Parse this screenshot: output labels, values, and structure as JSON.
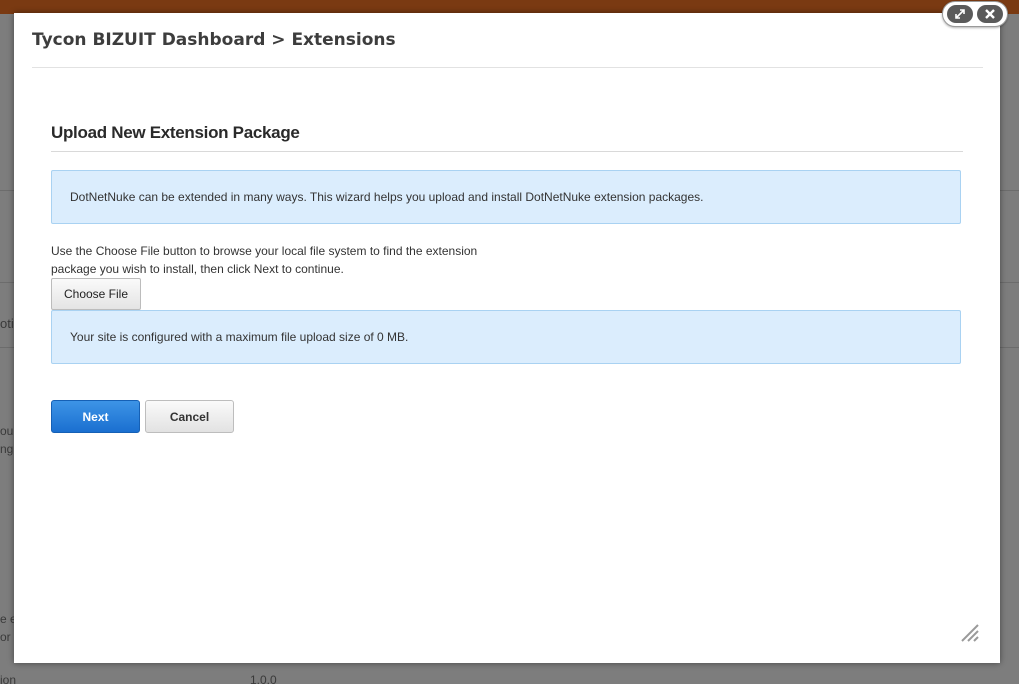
{
  "dialog": {
    "title": "Tycon BIZUIT Dashboard > Extensions",
    "section_heading": "Upload New Extension Package",
    "intro_message": "DotNetNuke can be extended in many ways. This wizard helps you upload and install DotNetNuke extension packages.",
    "instructions_line1": "Use the Choose File button to browse your local file system to find the extension",
    "instructions_line2": "package you wish to install, then click Next to continue.",
    "choose_file_label": "Choose File",
    "max_size_message": "Your site is configured with a maximum file upload size of 0 MB.",
    "next_label": "Next",
    "cancel_label": "Cancel"
  },
  "window_controls": {
    "maximize_icon": "maximize-icon",
    "close_icon": "close-icon"
  },
  "background_page": {
    "fragments": [
      "oti",
      "ou",
      "ng",
      "e e",
      "or",
      "ion",
      "1.0.0"
    ]
  },
  "colors": {
    "primary_button": "#1a6fd0",
    "info_background": "#dbedfd",
    "info_border": "#a9d2f2",
    "top_bar": "#7a3a12"
  }
}
